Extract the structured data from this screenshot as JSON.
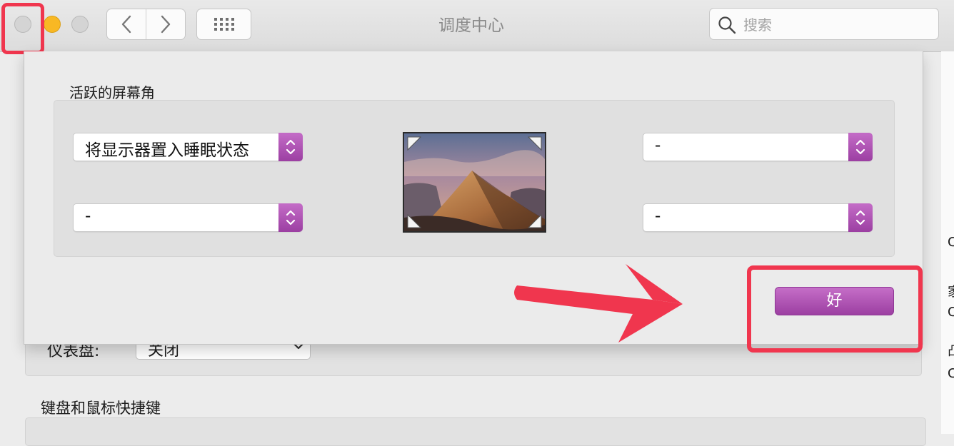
{
  "window": {
    "title": "调度中心",
    "search_placeholder": "搜索"
  },
  "underlying": {
    "dashboard_label": "仪表盘:",
    "dashboard_value": "关闭",
    "keyboard_title": "键盘和鼠标快捷键",
    "edge_glyphs": [
      "C",
      "家",
      "C",
      "凸",
      "C"
    ]
  },
  "sheet": {
    "section_title": "活跃的屏幕角",
    "corners": {
      "top_left": "将显示器置入睡眠状态",
      "top_right": "-",
      "bottom_left": "-",
      "bottom_right": "-"
    },
    "ok_label": "好"
  },
  "colors": {
    "accent_purple": "#b055b5",
    "annotation_red": "#f0364e",
    "traffic_yellow": "#f8b824"
  },
  "icons": [
    "back-arrow-icon",
    "forward-arrow-icon",
    "grid-icon",
    "search-icon",
    "stepper-chevrons-icon",
    "chevron-down-icon",
    "hot-corner-icon"
  ]
}
